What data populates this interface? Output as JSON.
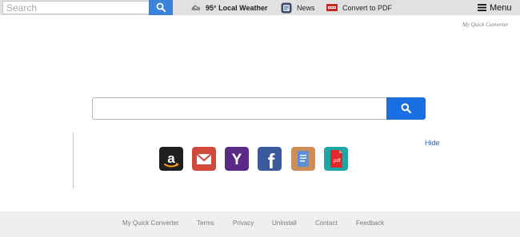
{
  "topbar": {
    "search": {
      "placeholder": "Search",
      "value": "",
      "button_icon": "search-icon",
      "button_color": "#3b82dd"
    },
    "nav": {
      "weather": {
        "label": "95° Local Weather",
        "icon": "weather-icon"
      },
      "news": {
        "label": "News",
        "icon": "news-icon"
      },
      "pdf": {
        "label": "Convert to PDF",
        "icon": "pdf-icon"
      }
    },
    "menu": {
      "label": "Menu",
      "icon": "hamburger-icon"
    }
  },
  "brand": {
    "text": "My Quick Converter"
  },
  "main_search": {
    "placeholder": "",
    "value": "",
    "button_icon": "search-icon",
    "button_color": "#1a6fe3"
  },
  "shortcuts": {
    "hide_label": "Hide",
    "items": [
      {
        "icon": "amazon-icon",
        "color": "#1f1f1f"
      },
      {
        "icon": "gmail-icon",
        "color": "#d1493a"
      },
      {
        "icon": "yahoo-icon",
        "color": "#5b2a86"
      },
      {
        "icon": "facebook-icon",
        "color": "#3b5a9c"
      },
      {
        "icon": "docs-icon",
        "color": "#cf8d57"
      },
      {
        "icon": "pdf-file-icon",
        "color": "#1ea6a5"
      }
    ]
  },
  "footer": {
    "links": [
      "My Quick Converter",
      "Terms",
      "Privacy",
      "Uninstall",
      "Contact",
      "Feedback"
    ]
  }
}
